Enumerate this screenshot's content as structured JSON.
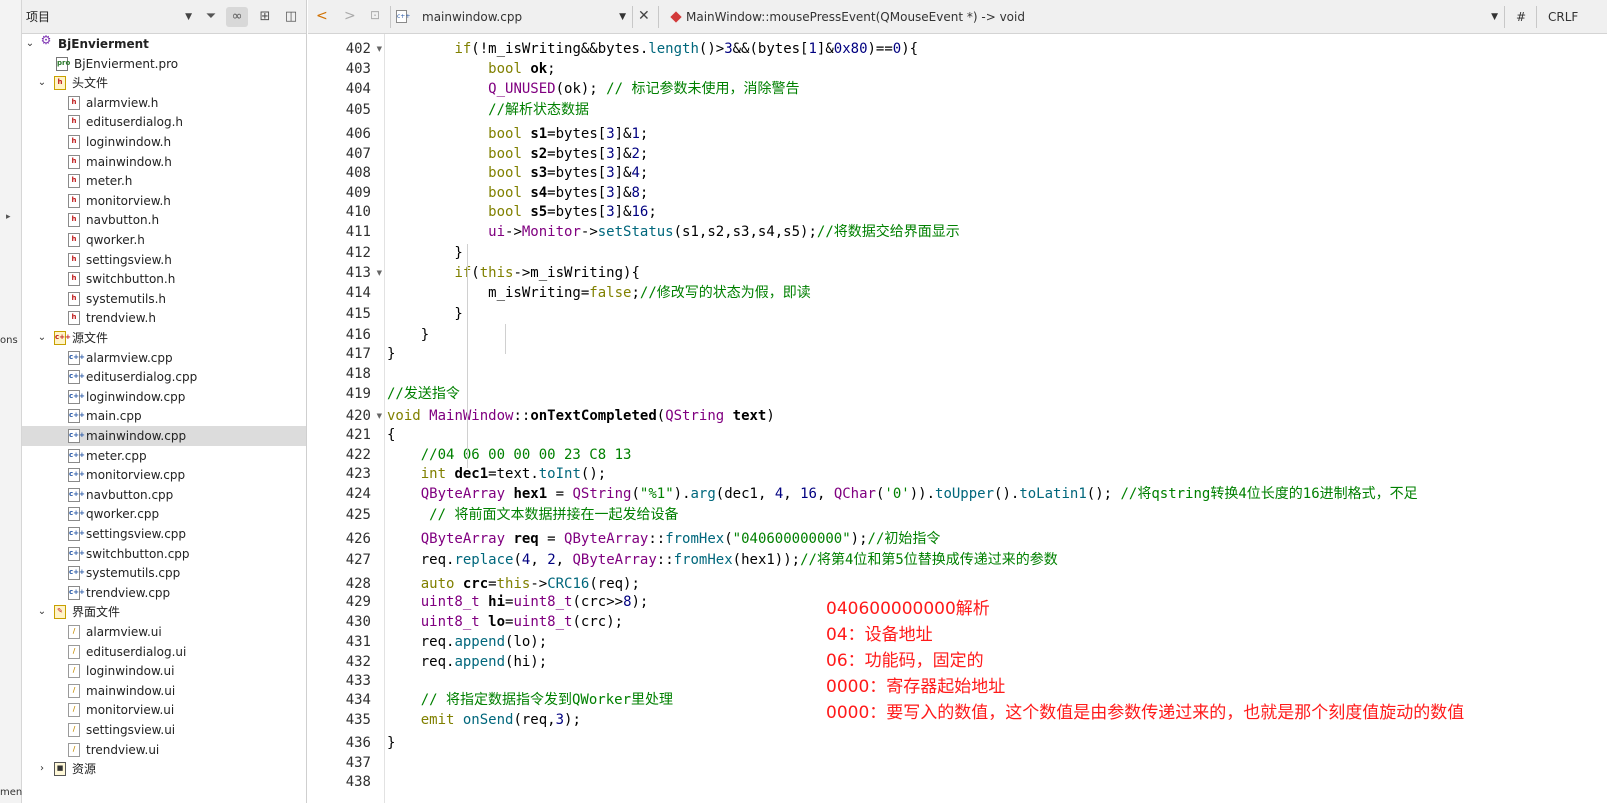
{
  "modebar": {
    "cut_label_1": "ons",
    "cut_label_2": "ment"
  },
  "project_panel": {
    "selector_label": "项目",
    "tree": [
      {
        "text": "BjEnvierment",
        "depth": 0,
        "kind": "root",
        "expanded": true,
        "bold": true
      },
      {
        "text": "BjEnvierment.pro",
        "depth": 1,
        "kind": "pro"
      },
      {
        "text": "头文件",
        "depth": 1,
        "kind": "folder-h",
        "expanded": true
      },
      {
        "text": "alarmview.h",
        "depth": 2,
        "kind": "h"
      },
      {
        "text": "edituserdialog.h",
        "depth": 2,
        "kind": "h"
      },
      {
        "text": "loginwindow.h",
        "depth": 2,
        "kind": "h"
      },
      {
        "text": "mainwindow.h",
        "depth": 2,
        "kind": "h"
      },
      {
        "text": "meter.h",
        "depth": 2,
        "kind": "h"
      },
      {
        "text": "monitorview.h",
        "depth": 2,
        "kind": "h"
      },
      {
        "text": "navbutton.h",
        "depth": 2,
        "kind": "h"
      },
      {
        "text": "qworker.h",
        "depth": 2,
        "kind": "h"
      },
      {
        "text": "settingsview.h",
        "depth": 2,
        "kind": "h"
      },
      {
        "text": "switchbutton.h",
        "depth": 2,
        "kind": "h"
      },
      {
        "text": "systemutils.h",
        "depth": 2,
        "kind": "h"
      },
      {
        "text": "trendview.h",
        "depth": 2,
        "kind": "h"
      },
      {
        "text": "源文件",
        "depth": 1,
        "kind": "folder-cpp",
        "expanded": true
      },
      {
        "text": "alarmview.cpp",
        "depth": 2,
        "kind": "cpp"
      },
      {
        "text": "edituserdialog.cpp",
        "depth": 2,
        "kind": "cpp"
      },
      {
        "text": "loginwindow.cpp",
        "depth": 2,
        "kind": "cpp"
      },
      {
        "text": "main.cpp",
        "depth": 2,
        "kind": "cpp"
      },
      {
        "text": "mainwindow.cpp",
        "depth": 2,
        "kind": "cpp",
        "selected": true
      },
      {
        "text": "meter.cpp",
        "depth": 2,
        "kind": "cpp"
      },
      {
        "text": "monitorview.cpp",
        "depth": 2,
        "kind": "cpp"
      },
      {
        "text": "navbutton.cpp",
        "depth": 2,
        "kind": "cpp"
      },
      {
        "text": "qworker.cpp",
        "depth": 2,
        "kind": "cpp"
      },
      {
        "text": "settingsview.cpp",
        "depth": 2,
        "kind": "cpp"
      },
      {
        "text": "switchbutton.cpp",
        "depth": 2,
        "kind": "cpp"
      },
      {
        "text": "systemutils.cpp",
        "depth": 2,
        "kind": "cpp"
      },
      {
        "text": "trendview.cpp",
        "depth": 2,
        "kind": "cpp"
      },
      {
        "text": "界面文件",
        "depth": 1,
        "kind": "folder-ui",
        "expanded": true
      },
      {
        "text": "alarmview.ui",
        "depth": 2,
        "kind": "ui"
      },
      {
        "text": "edituserdialog.ui",
        "depth": 2,
        "kind": "ui"
      },
      {
        "text": "loginwindow.ui",
        "depth": 2,
        "kind": "ui"
      },
      {
        "text": "mainwindow.ui",
        "depth": 2,
        "kind": "ui"
      },
      {
        "text": "monitorview.ui",
        "depth": 2,
        "kind": "ui"
      },
      {
        "text": "settingsview.ui",
        "depth": 2,
        "kind": "ui"
      },
      {
        "text": "trendview.ui",
        "depth": 2,
        "kind": "ui"
      },
      {
        "text": "资源",
        "depth": 1,
        "kind": "res",
        "expanded": false
      }
    ]
  },
  "editor_header": {
    "file_name": "mainwindow.cpp",
    "symbol": "MainWindow::mousePressEvent(QMouseEvent *) -> void",
    "hash_label": "#",
    "line_ending": "CRLF"
  },
  "editor": {
    "fold_lines": [
      402,
      413,
      420
    ],
    "lines": [
      {
        "n": 402,
        "t": [
          [
            "        ",
            ""
          ],
          [
            "if",
            "kw"
          ],
          [
            "(!m_isWriting&&bytes.",
            ""
          ],
          [
            "length",
            "fn"
          ],
          [
            "()>",
            ""
          ],
          [
            "3",
            "nm"
          ],
          [
            "&&(bytes[",
            ""
          ],
          [
            "1",
            "nm"
          ],
          [
            "]&",
            ""
          ],
          [
            "0x80",
            "nm"
          ],
          [
            ")==",
            ""
          ],
          [
            "0",
            "nm"
          ],
          [
            "){",
            ""
          ]
        ]
      },
      {
        "n": 403,
        "t": [
          [
            "            ",
            ""
          ],
          [
            "bool",
            "kw"
          ],
          [
            " ",
            ""
          ],
          [
            "ok",
            "bd"
          ],
          [
            ";",
            ""
          ]
        ]
      },
      {
        "n": 404,
        "t": [
          [
            "            ",
            ""
          ],
          [
            "Q_UNUSED",
            "ty"
          ],
          [
            "(ok); ",
            ""
          ],
          [
            "// 标记参数未使用，消除警告",
            "cm"
          ]
        ]
      },
      {
        "n": 405,
        "t": [
          [
            "            ",
            ""
          ],
          [
            "//解析状态数据",
            "cm"
          ]
        ]
      },
      {
        "n": 406,
        "t": [
          [
            "            ",
            ""
          ],
          [
            "bool",
            "kw"
          ],
          [
            " ",
            ""
          ],
          [
            "s1",
            "bd"
          ],
          [
            "=bytes[",
            ""
          ],
          [
            "3",
            "nm"
          ],
          [
            "]&",
            ""
          ],
          [
            "1",
            "nm"
          ],
          [
            ";",
            ""
          ]
        ]
      },
      {
        "n": 407,
        "t": [
          [
            "            ",
            ""
          ],
          [
            "bool",
            "kw"
          ],
          [
            " ",
            ""
          ],
          [
            "s2",
            "bd"
          ],
          [
            "=bytes[",
            ""
          ],
          [
            "3",
            "nm"
          ],
          [
            "]&",
            ""
          ],
          [
            "2",
            "nm"
          ],
          [
            ";",
            ""
          ]
        ]
      },
      {
        "n": 408,
        "t": [
          [
            "            ",
            ""
          ],
          [
            "bool",
            "kw"
          ],
          [
            " ",
            ""
          ],
          [
            "s3",
            "bd"
          ],
          [
            "=bytes[",
            ""
          ],
          [
            "3",
            "nm"
          ],
          [
            "]&",
            ""
          ],
          [
            "4",
            "nm"
          ],
          [
            ";",
            ""
          ]
        ]
      },
      {
        "n": 409,
        "t": [
          [
            "            ",
            ""
          ],
          [
            "bool",
            "kw"
          ],
          [
            " ",
            ""
          ],
          [
            "s4",
            "bd"
          ],
          [
            "=bytes[",
            ""
          ],
          [
            "3",
            "nm"
          ],
          [
            "]&",
            ""
          ],
          [
            "8",
            "nm"
          ],
          [
            ";",
            ""
          ]
        ]
      },
      {
        "n": 410,
        "t": [
          [
            "            ",
            ""
          ],
          [
            "bool",
            "kw"
          ],
          [
            " ",
            ""
          ],
          [
            "s5",
            "bd"
          ],
          [
            "=bytes[",
            ""
          ],
          [
            "3",
            "nm"
          ],
          [
            "]&",
            ""
          ],
          [
            "16",
            "nm"
          ],
          [
            ";",
            ""
          ]
        ]
      },
      {
        "n": 411,
        "t": [
          [
            "            ",
            ""
          ],
          [
            "ui",
            "ty"
          ],
          [
            "->",
            ""
          ],
          [
            "Monitor",
            "ty"
          ],
          [
            "->",
            ""
          ],
          [
            "setStatus",
            "fn"
          ],
          [
            "(s1,s2,s3,s4,s5);",
            ""
          ],
          [
            "//将数据交给界面显示",
            "cm"
          ]
        ]
      },
      {
        "n": 412,
        "t": [
          [
            "        }",
            ""
          ]
        ]
      },
      {
        "n": 413,
        "t": [
          [
            "        ",
            ""
          ],
          [
            "if",
            "kw"
          ],
          [
            "(",
            ""
          ],
          [
            "this",
            "kw"
          ],
          [
            "->m_isWriting){",
            ""
          ]
        ]
      },
      {
        "n": 414,
        "t": [
          [
            "            m_isWriting=",
            ""
          ],
          [
            "false",
            "kw"
          ],
          [
            ";",
            ""
          ],
          [
            "//修改写的状态为假，即读",
            "cm"
          ]
        ]
      },
      {
        "n": 415,
        "t": [
          [
            "        }",
            ""
          ]
        ]
      },
      {
        "n": 416,
        "t": [
          [
            "    }",
            ""
          ]
        ]
      },
      {
        "n": 417,
        "t": [
          [
            "}",
            ""
          ]
        ]
      },
      {
        "n": 418,
        "t": []
      },
      {
        "n": 419,
        "t": [
          [
            "//发送指令",
            "cm"
          ]
        ]
      },
      {
        "n": 420,
        "t": [
          [
            "void",
            "kw"
          ],
          [
            " ",
            ""
          ],
          [
            "MainWindow",
            "ty"
          ],
          [
            "::",
            ""
          ],
          [
            "onTextCompleted",
            "bd"
          ],
          [
            "(",
            ""
          ],
          [
            "QString",
            "ty"
          ],
          [
            " ",
            ""
          ],
          [
            "text",
            "bd"
          ],
          [
            ")",
            ""
          ]
        ]
      },
      {
        "n": 421,
        "t": [
          [
            "{",
            ""
          ]
        ]
      },
      {
        "n": 422,
        "t": [
          [
            "    ",
            ""
          ],
          [
            "//04 06 00 00 00 23 C8 13",
            "cm"
          ]
        ]
      },
      {
        "n": 423,
        "t": [
          [
            "    ",
            ""
          ],
          [
            "int",
            "kw"
          ],
          [
            " ",
            ""
          ],
          [
            "dec1",
            "bd"
          ],
          [
            "=text.",
            ""
          ],
          [
            "toInt",
            "fn"
          ],
          [
            "();",
            ""
          ]
        ]
      },
      {
        "n": 424,
        "t": [
          [
            "    ",
            ""
          ],
          [
            "QByteArray",
            "ty"
          ],
          [
            " ",
            ""
          ],
          [
            "hex1",
            "bd"
          ],
          [
            " = ",
            ""
          ],
          [
            "QString",
            "ty"
          ],
          [
            "(",
            ""
          ],
          [
            "\"%1\"",
            "st"
          ],
          [
            ").",
            ""
          ],
          [
            "arg",
            "fn"
          ],
          [
            "(dec1, ",
            ""
          ],
          [
            "4",
            "nm"
          ],
          [
            ", ",
            ""
          ],
          [
            "16",
            "nm"
          ],
          [
            ", ",
            ""
          ],
          [
            "QChar",
            "ty"
          ],
          [
            "(",
            ""
          ],
          [
            "'0'",
            "st"
          ],
          [
            ")).",
            ""
          ],
          [
            "toUpper",
            "fn"
          ],
          [
            "().",
            ""
          ],
          [
            "toLatin1",
            "fn"
          ],
          [
            "(); ",
            ""
          ],
          [
            "//将qstring转换4位长度的16进制格式，不足",
            "cm"
          ]
        ]
      },
      {
        "n": 425,
        "t": [
          [
            "     ",
            ""
          ],
          [
            "// 将前面文本数据拼接在一起发给设备",
            "cm"
          ]
        ]
      },
      {
        "n": 426,
        "t": [
          [
            "    ",
            ""
          ],
          [
            "QByteArray",
            "ty"
          ],
          [
            " ",
            ""
          ],
          [
            "req",
            "bd"
          ],
          [
            " = ",
            ""
          ],
          [
            "QByteArray",
            "ty"
          ],
          [
            "::",
            ""
          ],
          [
            "fromHex",
            "fn"
          ],
          [
            "(",
            ""
          ],
          [
            "\"040600000000\"",
            "st"
          ],
          [
            ");",
            ""
          ],
          [
            "//初始指令",
            "cm"
          ]
        ]
      },
      {
        "n": 427,
        "t": [
          [
            "    req.",
            ""
          ],
          [
            "replace",
            "fn"
          ],
          [
            "(",
            ""
          ],
          [
            "4",
            "nm"
          ],
          [
            ", ",
            ""
          ],
          [
            "2",
            "nm"
          ],
          [
            ", ",
            ""
          ],
          [
            "QByteArray",
            "ty"
          ],
          [
            "::",
            ""
          ],
          [
            "fromHex",
            "fn"
          ],
          [
            "(hex1));",
            ""
          ],
          [
            "//将第4位和第5位替换成传递过来的参数",
            "cm"
          ]
        ]
      },
      {
        "n": 428,
        "t": [
          [
            "    ",
            ""
          ],
          [
            "auto",
            "kw"
          ],
          [
            " ",
            ""
          ],
          [
            "crc",
            "bd"
          ],
          [
            "=",
            ""
          ],
          [
            "this",
            "kw"
          ],
          [
            "->",
            ""
          ],
          [
            "CRC16",
            "fn"
          ],
          [
            "(req);",
            ""
          ]
        ]
      },
      {
        "n": 429,
        "t": [
          [
            "    ",
            ""
          ],
          [
            "uint8_t",
            "ty"
          ],
          [
            " ",
            ""
          ],
          [
            "hi",
            "bd"
          ],
          [
            "=",
            ""
          ],
          [
            "uint8_t",
            "ty"
          ],
          [
            "(crc>>",
            ""
          ],
          [
            "8",
            "nm"
          ],
          [
            ");",
            ""
          ]
        ]
      },
      {
        "n": 430,
        "t": [
          [
            "    ",
            ""
          ],
          [
            "uint8_t",
            "ty"
          ],
          [
            " ",
            ""
          ],
          [
            "lo",
            "bd"
          ],
          [
            "=",
            ""
          ],
          [
            "uint8_t",
            "ty"
          ],
          [
            "(crc);",
            ""
          ]
        ]
      },
      {
        "n": 431,
        "t": [
          [
            "    req.",
            ""
          ],
          [
            "append",
            "fn"
          ],
          [
            "(lo);",
            ""
          ]
        ]
      },
      {
        "n": 432,
        "t": [
          [
            "    req.",
            ""
          ],
          [
            "append",
            "fn"
          ],
          [
            "(hi);",
            ""
          ]
        ]
      },
      {
        "n": 433,
        "t": []
      },
      {
        "n": 434,
        "t": [
          [
            "    ",
            ""
          ],
          [
            "// 将指定数据指令发到QWorker里处理",
            "cm"
          ]
        ]
      },
      {
        "n": 435,
        "t": [
          [
            "    ",
            ""
          ],
          [
            "emit",
            "kw"
          ],
          [
            " ",
            ""
          ],
          [
            "onSend",
            "fn"
          ],
          [
            "(req,",
            ""
          ],
          [
            "3",
            "nm"
          ],
          [
            ");",
            ""
          ]
        ]
      },
      {
        "n": 436,
        "t": [
          [
            "}",
            ""
          ]
        ]
      },
      {
        "n": 437,
        "t": []
      },
      {
        "n": 438,
        "t": []
      }
    ],
    "annotation": [
      "040600000000解析",
      "04：设备地址",
      "06：功能码，固定的",
      "0000：寄存器起始地址",
      "0000：要写入的数值，这个数值是由参数传递过来的，也就是那个刻度值旋动的数值"
    ]
  },
  "colors": {
    "annotation": "#ff1a1a",
    "keyword": "#808000",
    "type": "#800080",
    "function": "#00677c",
    "comment": "#008000",
    "number": "#000080",
    "selection": "#dcdcdc"
  }
}
